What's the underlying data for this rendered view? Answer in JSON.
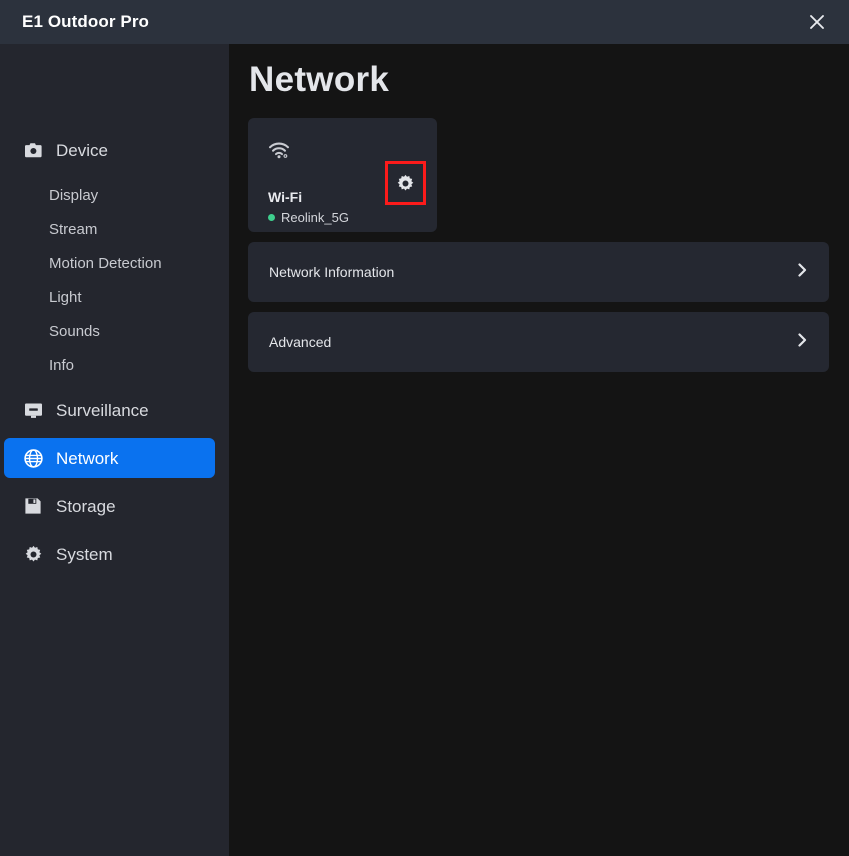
{
  "titlebar": {
    "title": "E1 Outdoor Pro",
    "close_icon": "close-icon"
  },
  "sidebar": {
    "items": [
      {
        "label": "Device",
        "icon": "camera-icon",
        "active": false
      },
      {
        "label": "Surveillance",
        "icon": "monitor-icon",
        "active": false
      },
      {
        "label": "Network",
        "icon": "globe-icon",
        "active": true
      },
      {
        "label": "Storage",
        "icon": "floppy-disk-icon",
        "active": false
      },
      {
        "label": "System",
        "icon": "gear-icon",
        "active": false
      }
    ],
    "device_subitems": [
      {
        "label": "Display"
      },
      {
        "label": "Stream"
      },
      {
        "label": "Motion Detection"
      },
      {
        "label": "Light"
      },
      {
        "label": "Sounds"
      },
      {
        "label": "Info"
      }
    ]
  },
  "main": {
    "page_title": "Network",
    "wifi_card": {
      "icon": "wifi-icon",
      "title": "Wi-Fi",
      "ssid": "Reolink_5G",
      "status_color": "#3ecf8e",
      "settings_icon": "gear-icon",
      "highlight_color": "#fc1b1b"
    },
    "rows": [
      {
        "label": "Network Information",
        "chevron": "chevron-right-icon"
      },
      {
        "label": "Advanced",
        "chevron": "chevron-right-icon"
      }
    ]
  },
  "colors": {
    "titlebar_bg": "#2c323d",
    "sidebar_bg": "#24262e",
    "content_bg": "#141414",
    "card_bg": "#252831",
    "accent": "#0a72ef",
    "status_green": "#3ecf8e",
    "highlight_red": "#fc1b1b"
  }
}
